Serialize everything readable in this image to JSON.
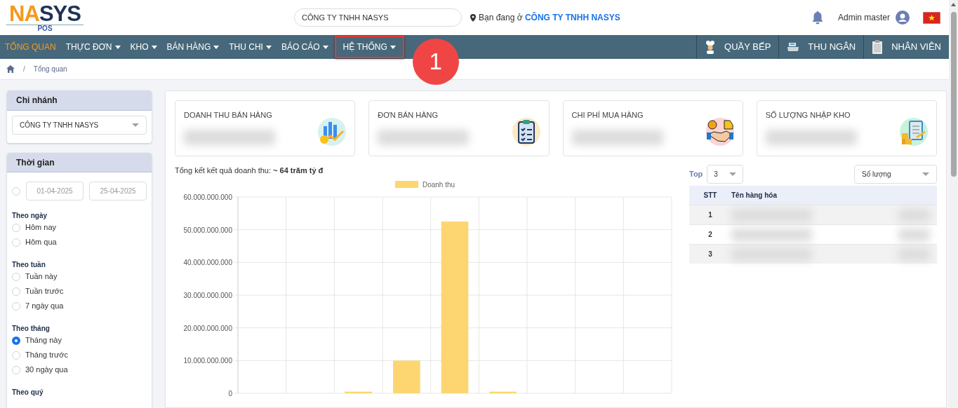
{
  "header": {
    "logo": {
      "part_a": "NA",
      "part_b": "SYS",
      "sub": "POS"
    },
    "company_field": {
      "value": "CÔNG TY TNHH NASYS"
    },
    "location": {
      "prefix": "Bạn đang ở",
      "company": "CÔNG TY TNHH NASYS"
    },
    "user": "Admin master"
  },
  "nav": {
    "items": [
      {
        "label": "TỔNG QUAN",
        "selected": true,
        "dropdown": false,
        "highlighted": false
      },
      {
        "label": "THỰC ĐƠN",
        "selected": false,
        "dropdown": true,
        "highlighted": false
      },
      {
        "label": "KHO",
        "selected": false,
        "dropdown": true,
        "highlighted": false
      },
      {
        "label": "BÁN HÀNG",
        "selected": false,
        "dropdown": true,
        "highlighted": false
      },
      {
        "label": "THU CHI",
        "selected": false,
        "dropdown": true,
        "highlighted": false
      },
      {
        "label": "BÁO CÁO",
        "selected": false,
        "dropdown": true,
        "highlighted": false
      },
      {
        "label": "HỆ THỐNG",
        "selected": false,
        "dropdown": true,
        "highlighted": true
      }
    ],
    "right_items": [
      {
        "label": "QUẦY BẾP",
        "kind": "chef"
      },
      {
        "label": "THU NGÂN",
        "kind": "cashier"
      },
      {
        "label": "NHÂN VIÊN",
        "kind": "staff"
      }
    ]
  },
  "annotation": {
    "step": "1"
  },
  "breadcrumb": {
    "separator": "/",
    "current": "Tổng quan"
  },
  "sidebar": {
    "branch": {
      "title": "Chi nhánh",
      "value": "CÔNG TY TNHH NASYS"
    },
    "time": {
      "title": "Thời gian",
      "range": {
        "selected": false,
        "from": "01-04-2025",
        "to": "25-04-2025"
      },
      "groups": [
        {
          "label": "Theo ngày",
          "options": [
            {
              "label": "Hôm nay",
              "selected": false
            },
            {
              "label": "Hôm qua",
              "selected": false
            }
          ]
        },
        {
          "label": "Theo tuần",
          "options": [
            {
              "label": "Tuần này",
              "selected": false
            },
            {
              "label": "Tuần trước",
              "selected": false
            },
            {
              "label": "7 ngày qua",
              "selected": false
            }
          ]
        },
        {
          "label": "Theo tháng",
          "options": [
            {
              "label": "Tháng này",
              "selected": true
            },
            {
              "label": "Tháng trước",
              "selected": false
            },
            {
              "label": "30 ngày qua",
              "selected": false
            }
          ]
        },
        {
          "label": "Theo quý"
        }
      ]
    }
  },
  "stats": [
    {
      "title": "DOANH THU BÁN HÀNG",
      "kind": "revenue"
    },
    {
      "title": "ĐƠN BÁN HÀNG",
      "kind": "orders"
    },
    {
      "title": "CHI PHÍ MUA HÀNG",
      "kind": "purchase"
    },
    {
      "title": "SỐ LƯỢNG NHẬP KHO",
      "kind": "stock"
    }
  ],
  "summary": {
    "label": "Tổng kết kết quả doanh thu:",
    "value": "~ 64 trăm tỷ đ"
  },
  "chart": {
    "chart_data": {
      "type": "bar",
      "grid": true,
      "ylim": [
        0,
        60000000000
      ],
      "yticks": [
        {
          "value": 0,
          "label": "0"
        },
        {
          "value": 10000000000,
          "label": "10.000.000.000"
        },
        {
          "value": 20000000000,
          "label": "20.000.000.000"
        },
        {
          "value": 30000000000,
          "label": "30.000.000.000"
        },
        {
          "value": 40000000000,
          "label": "40.000.000.000"
        },
        {
          "value": 50000000000,
          "label": "50.000.000.000"
        },
        {
          "value": 60000000000,
          "label": "60.000.000.000"
        }
      ],
      "series": [
        {
          "name": "Doanh thu",
          "color": "#fdd672",
          "values": [
            null,
            null,
            500000000,
            10000000000,
            52500000000,
            500000000,
            null,
            null,
            null
          ]
        }
      ]
    }
  },
  "top": {
    "label": "Top",
    "count": "3",
    "metric": "Số lượng",
    "columns": [
      "STT",
      "Tên hàng hóa"
    ],
    "rows": [
      {
        "stt": "1"
      },
      {
        "stt": "2"
      },
      {
        "stt": "3"
      }
    ]
  }
}
